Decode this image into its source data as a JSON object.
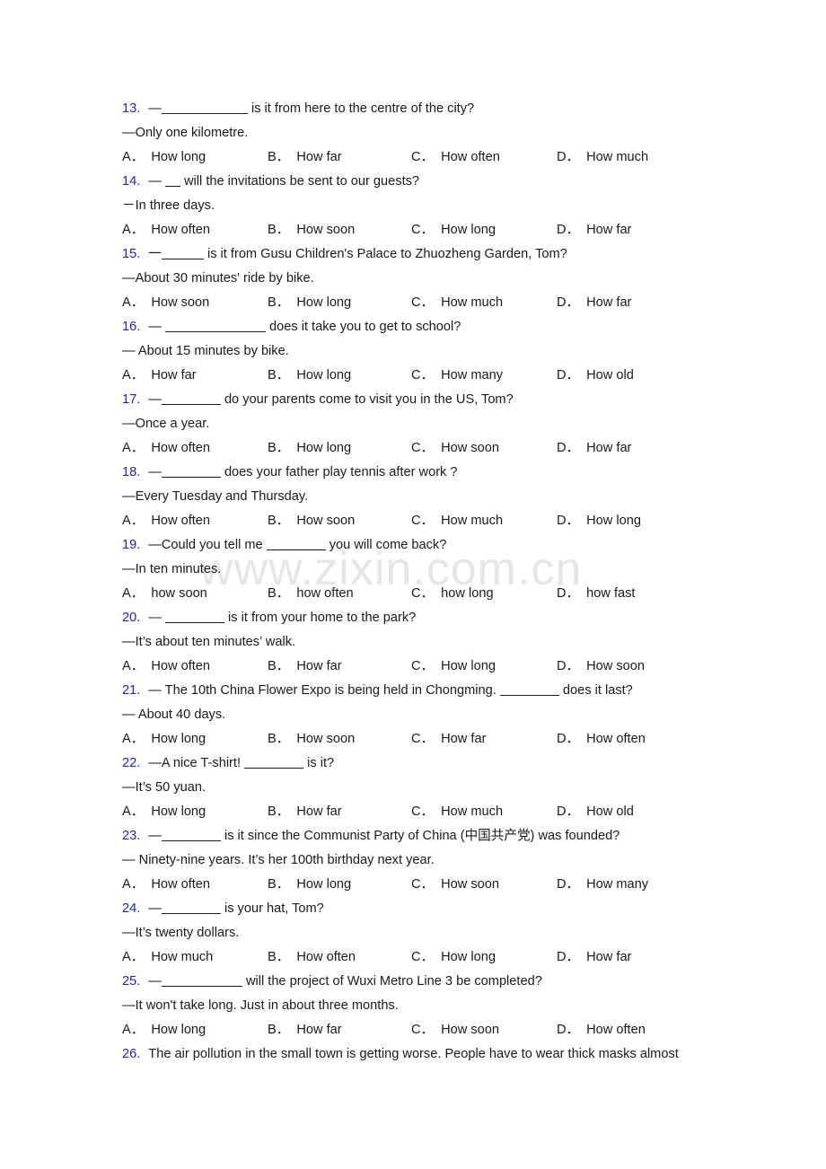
{
  "watermark": {
    "text": "www.zixin.com.cn",
    "color": "#e6e6e6"
  },
  "theme": {
    "number_color": "#2222cc",
    "text_color": "#1a1a1a",
    "page_background": "#ffffff"
  },
  "questions": [
    {
      "number": "13.",
      "stem_before": "—",
      "blank_width": 96,
      "stem_after": " is it from here to the centre of the city?",
      "reply": "—Only one kilometre.",
      "options": [
        {
          "label": "A．",
          "text": "How long"
        },
        {
          "label": "B．",
          "text": "How far"
        },
        {
          "label": "C．",
          "text": "How often"
        },
        {
          "label": "D．",
          "text": "How much"
        }
      ]
    },
    {
      "number": "14.",
      "stem_before": "— ",
      "blank_width": 17,
      "stem_after": " will the invitations be sent to our guests?",
      "reply": "－In three days.",
      "options": [
        {
          "label": "A．",
          "text": "How often"
        },
        {
          "label": "B．",
          "text": "How soon"
        },
        {
          "label": "C．",
          "text": "How long"
        },
        {
          "label": "D．",
          "text": "How far"
        }
      ]
    },
    {
      "number": "15.",
      "stem_before": "一",
      "blank_width": 47,
      "stem_after": " is it from Gusu Children's Palace to Zhuozheng Garden, Tom?",
      "reply": "—About 30 minutes' ride by bike.",
      "options": [
        {
          "label": "A．",
          "text": "How soon"
        },
        {
          "label": "B．",
          "text": "How long"
        },
        {
          "label": "C．",
          "text": "How much"
        },
        {
          "label": "D．",
          "text": "How far"
        }
      ]
    },
    {
      "number": "16.",
      "stem_before": "— ",
      "blank_width": 112,
      "stem_after": " does it take you to get to school?",
      "reply": "— About 15 minutes by bike.",
      "options": [
        {
          "label": "A．",
          "text": "How far"
        },
        {
          "label": "B．",
          "text": "How long"
        },
        {
          "label": "C．",
          "text": "How many"
        },
        {
          "label": "D．",
          "text": "How old"
        }
      ]
    },
    {
      "number": "17.",
      "stem_before": "—",
      "blank_width": 66,
      "stem_after": " do your parents come to visit you in the US, Tom?",
      "reply": "—Once a year.",
      "options": [
        {
          "label": "A．",
          "text": "How often"
        },
        {
          "label": "B．",
          "text": "How long"
        },
        {
          "label": "C．",
          "text": "How soon"
        },
        {
          "label": "D．",
          "text": "How far"
        }
      ]
    },
    {
      "number": "18.",
      "stem_before": "—",
      "blank_width": 66,
      "stem_after": " does your father play tennis after work ?",
      "reply": "—Every Tuesday and Thursday.",
      "options": [
        {
          "label": "A．",
          "text": "How often"
        },
        {
          "label": "B．",
          "text": "How soon"
        },
        {
          "label": "C．",
          "text": "How much"
        },
        {
          "label": "D．",
          "text": "How long"
        }
      ]
    },
    {
      "number": "19.",
      "stem_before": "—Could you tell me ",
      "blank_width": 66,
      "stem_after": " you will come back?",
      "reply": "—In ten minutes.",
      "options": [
        {
          "label": "A．",
          "text": "how soon"
        },
        {
          "label": "B．",
          "text": "how often"
        },
        {
          "label": "C．",
          "text": "how long"
        },
        {
          "label": "D．",
          "text": "how fast"
        }
      ]
    },
    {
      "number": "20.",
      "stem_before": "— ",
      "blank_width": 66,
      "stem_after": " is it from your home to the park?",
      "reply": "—It’s about ten minutes’ walk.",
      "options": [
        {
          "label": "A．",
          "text": "How often"
        },
        {
          "label": "B．",
          "text": "How far"
        },
        {
          "label": "C．",
          "text": "How long"
        },
        {
          "label": "D．",
          "text": "How soon"
        }
      ]
    },
    {
      "number": "21.",
      "stem_before": "— The 10th China Flower Expo is being held in Chongming. ",
      "blank_width": 66,
      "stem_after": " does it last?",
      "reply": "— About 40 days.",
      "options": [
        {
          "label": "A．",
          "text": "How long"
        },
        {
          "label": "B．",
          "text": "How soon"
        },
        {
          "label": "C．",
          "text": "How far"
        },
        {
          "label": "D．",
          "text": "How often"
        }
      ]
    },
    {
      "number": "22.",
      "stem_before": "—A nice T-shirt! ",
      "blank_width": 66,
      "stem_after": " is it?",
      "reply": "—It’s 50 yuan.",
      "options": [
        {
          "label": "A．",
          "text": "How long"
        },
        {
          "label": "B．",
          "text": "How far"
        },
        {
          "label": "C．",
          "text": "How much"
        },
        {
          "label": "D．",
          "text": "How old"
        }
      ]
    },
    {
      "number": "23.",
      "stem_before": "—",
      "blank_width": 66,
      "stem_after": " is it since the Communist Party of China (中国共产党) was founded?",
      "reply": "— Ninety-nine years. It’s her 100th birthday next year.",
      "options": [
        {
          "label": "A．",
          "text": "How often"
        },
        {
          "label": "B．",
          "text": "How long"
        },
        {
          "label": "C．",
          "text": "How soon"
        },
        {
          "label": "D．",
          "text": "How many"
        }
      ]
    },
    {
      "number": "24.",
      "stem_before": "—",
      "blank_width": 66,
      "stem_after": " is your hat, Tom?",
      "reply": "—It’s twenty dollars.",
      "options": [
        {
          "label": "A．",
          "text": "How much"
        },
        {
          "label": "B．",
          "text": "How often"
        },
        {
          "label": "C．",
          "text": "How long"
        },
        {
          "label": "D．",
          "text": "How far"
        }
      ]
    },
    {
      "number": "25.",
      "stem_before": "—",
      "blank_width": 90,
      "stem_after": " will the project of Wuxi Metro Line 3 be completed?",
      "reply": "—It won't take long. Just in about three months.",
      "options": [
        {
          "label": "A．",
          "text": "How long"
        },
        {
          "label": "B．",
          "text": "How far"
        },
        {
          "label": "C．",
          "text": "How soon"
        },
        {
          "label": "D．",
          "text": "How often"
        }
      ]
    }
  ],
  "trailing_item": {
    "number": "26.",
    "text": "The air pollution in the small town is getting worse. People have to wear thick masks almost"
  }
}
